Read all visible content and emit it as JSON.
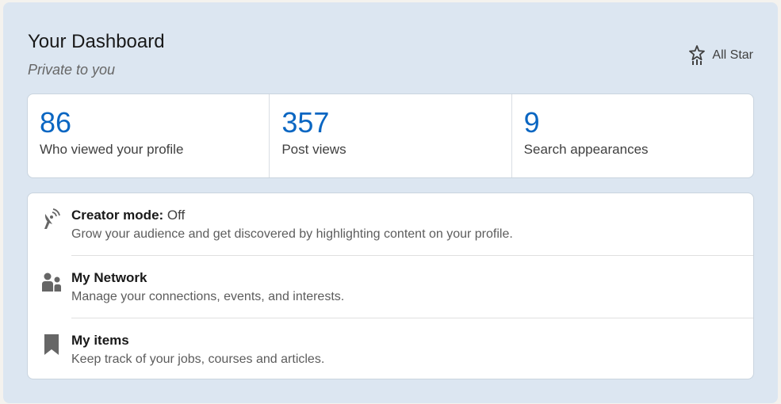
{
  "header": {
    "title": "Your Dashboard",
    "subtitle": "Private to you",
    "badge_label": "All Star",
    "badge_icon": "all-star-icon"
  },
  "stats": [
    {
      "value": "86",
      "label": "Who viewed your profile"
    },
    {
      "value": "357",
      "label": "Post views"
    },
    {
      "value": "9",
      "label": "Search appearances"
    }
  ],
  "items": [
    {
      "icon": "creator-mode-icon",
      "title": "Creator mode:",
      "title_suffix": "Off",
      "description": "Grow your audience and get discovered by highlighting content on your profile."
    },
    {
      "icon": "my-network-icon",
      "title": "My Network",
      "title_suffix": "",
      "description": "Manage your connections, events, and interests."
    },
    {
      "icon": "bookmark-icon",
      "title": "My items",
      "title_suffix": "",
      "description": "Keep track of your jobs, courses and articles."
    }
  ],
  "colors": {
    "panel_background": "#dce6f1",
    "stat_value": "#0a66c2",
    "icon": "#666666"
  }
}
